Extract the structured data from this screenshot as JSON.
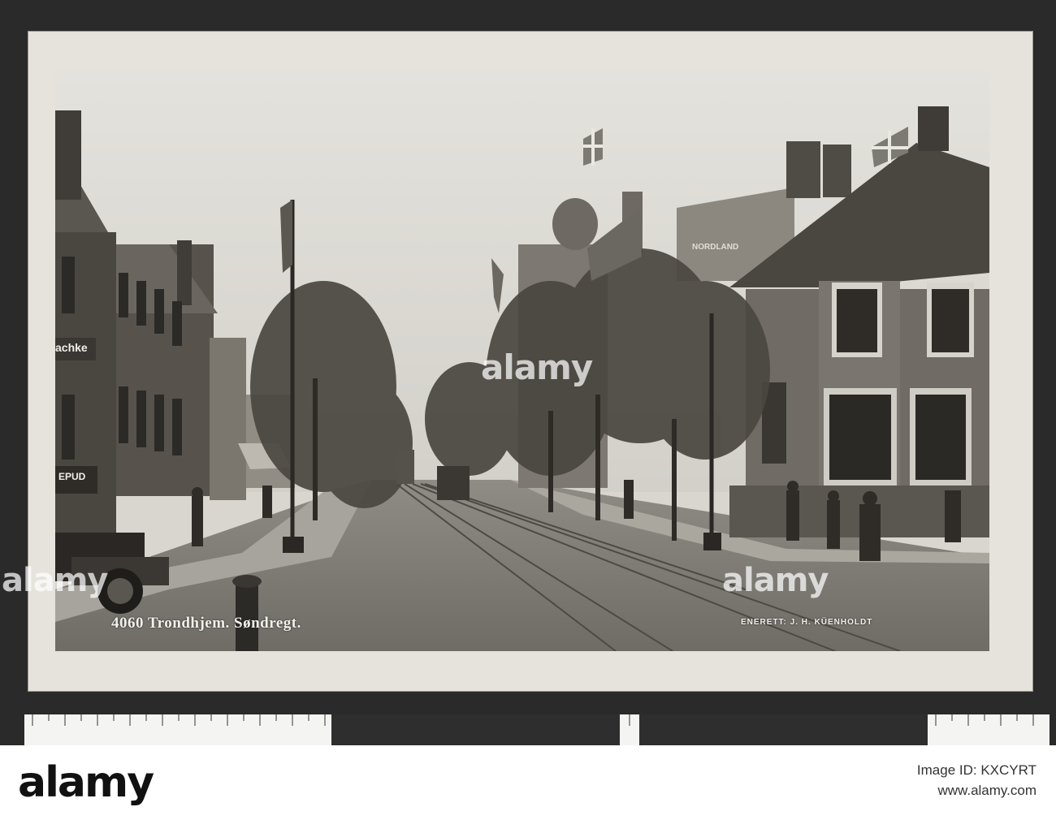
{
  "photo": {
    "caption_left": "4060 Trondhjem.  Søndregt.",
    "caption_right": "ENERETT: J. H. KÜENHOLDT",
    "shop_signs": {
      "left_building": "achke",
      "left_lower": "EPUD",
      "right_building": "NORDLAND"
    }
  },
  "watermarks": {
    "main": "alamy",
    "side_left": "alamy",
    "side_right": "alamy"
  },
  "footer": {
    "logo": "alamy",
    "image_id_line": "Image ID: KXCYRT",
    "url_line": "www.alamy.com"
  }
}
